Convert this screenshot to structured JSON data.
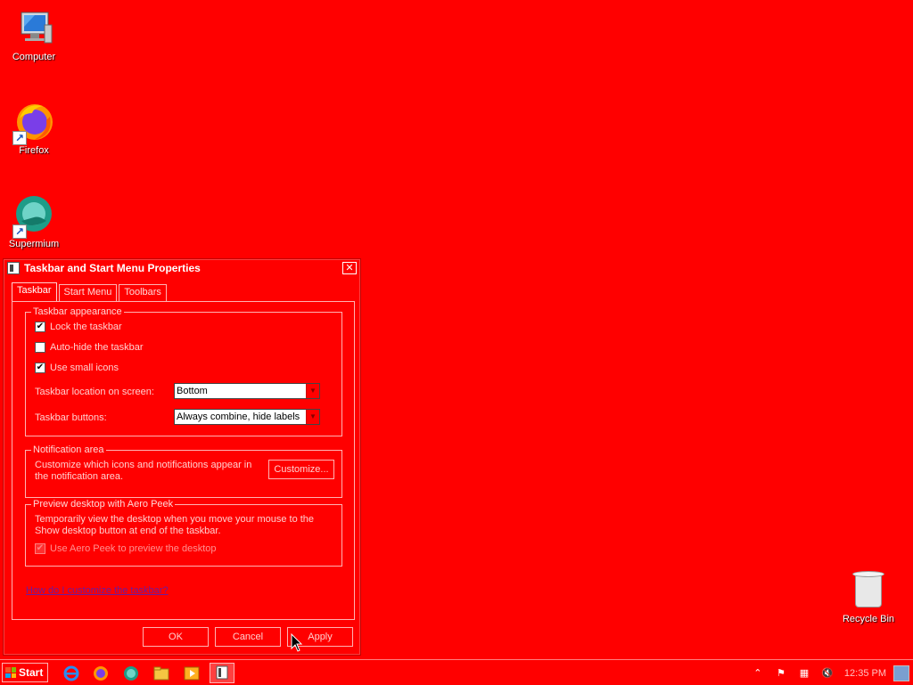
{
  "desktop": {
    "icons": [
      {
        "label": "Computer"
      },
      {
        "label": "Firefox"
      },
      {
        "label": "Supermium"
      },
      {
        "label": "Recycle Bin"
      }
    ]
  },
  "dialog": {
    "title": "Taskbar and Start Menu Properties",
    "close_glyph": "✕",
    "tabs": [
      {
        "label": "Taskbar",
        "active": true
      },
      {
        "label": "Start Menu",
        "active": false
      },
      {
        "label": "Toolbars",
        "active": false
      }
    ],
    "appearance": {
      "legend": "Taskbar appearance",
      "lock_label": "Lock the taskbar",
      "lock_checked": true,
      "autohide_label": "Auto-hide the taskbar",
      "autohide_checked": false,
      "small_icons_label": "Use small icons",
      "small_icons_checked": true,
      "location_label": "Taskbar location on screen:",
      "location_value": "Bottom",
      "buttons_label": "Taskbar buttons:",
      "buttons_value": "Always combine, hide labels"
    },
    "notification": {
      "legend": "Notification area",
      "description": "Customize which icons and notifications appear in the notification area.",
      "customize_label": "Customize..."
    },
    "aero_peek": {
      "legend": "Preview desktop with Aero Peek",
      "description": "Temporarily view the desktop when you move your mouse to the Show desktop button at end of the taskbar.",
      "checkbox_label": "Use Aero Peek to preview the desktop",
      "checked": true,
      "disabled": true
    },
    "help_link": "How do I customize the taskbar?",
    "ok_label": "OK",
    "cancel_label": "Cancel",
    "apply_label": "Apply"
  },
  "taskbar": {
    "start_label": "Start",
    "pinned": [
      "internet-explorer-icon",
      "firefox-icon",
      "supermium-icon",
      "file-explorer-icon",
      "media-player-icon",
      "taskbar-properties-icon"
    ],
    "clock": "12:35 PM",
    "colors": {
      "background": "#ff0000"
    }
  }
}
